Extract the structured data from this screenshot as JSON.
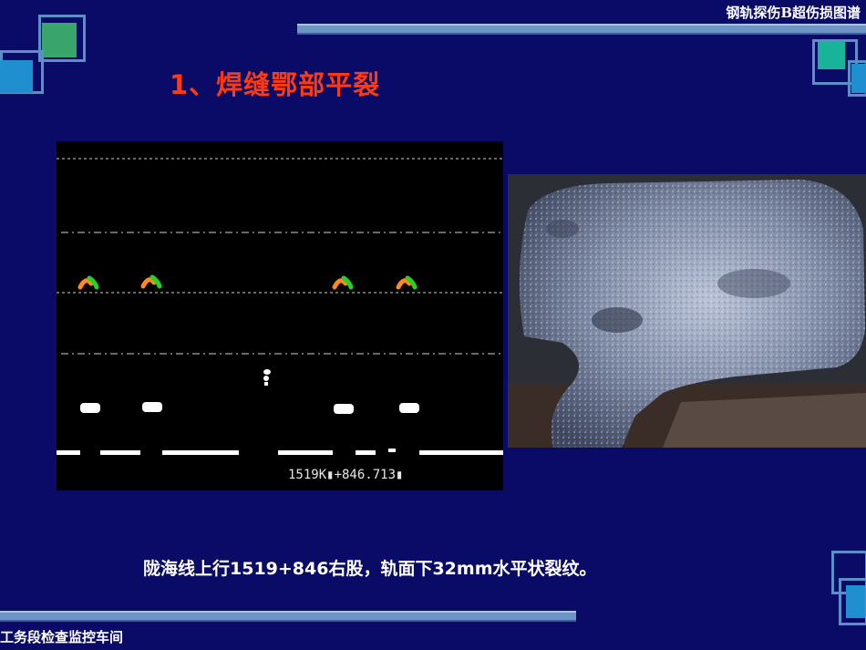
{
  "header": {
    "title": "钢轨探伤B超伤损图谱"
  },
  "slide": {
    "title": "1、焊缝鄂部平裂"
  },
  "scope": {
    "readout": "1519K▮+846.713▮"
  },
  "caption": {
    "text": "陇海线上行1519+846右股，轨面下32mm水平状裂纹。"
  },
  "footer": {
    "text": "工务段检查监控车间"
  },
  "colors": {
    "background": "#0a0b66",
    "title": "#ff3a12",
    "accent_teal": "#19b39a",
    "accent_green": "#3aa56a",
    "accent_blue": "#1f8fd0",
    "bar": "#6f95c4",
    "echo_orange": "#ff8a1f",
    "echo_green": "#27d02a"
  }
}
